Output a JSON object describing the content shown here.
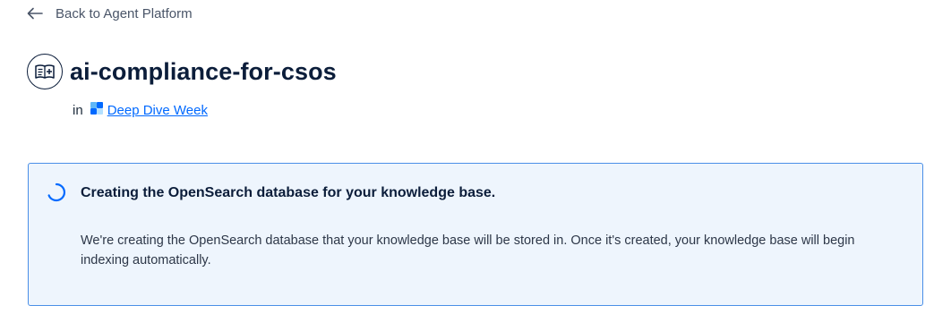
{
  "nav": {
    "back_label": "Back to Agent Platform",
    "back_icon": "arrow-left-icon"
  },
  "header": {
    "title": "ai-compliance-for-csos",
    "icon": "knowledge-base-icon",
    "in_label": "in",
    "project_icon": "project-icon",
    "project_name": "Deep Dive Week"
  },
  "status": {
    "icon": "loading-spinner-icon",
    "title": "Creating the OpenSearch database for your knowledge base.",
    "message": "We're creating the OpenSearch database that your knowledge base will be stored in. Once it's created, your knowledge base will begin indexing automatically."
  },
  "colors": {
    "link": "#0069ff",
    "title": "#0b1d3a",
    "status_border": "#4a8fe7",
    "status_background": "#eef5fd",
    "spinner": "#0069ff"
  }
}
